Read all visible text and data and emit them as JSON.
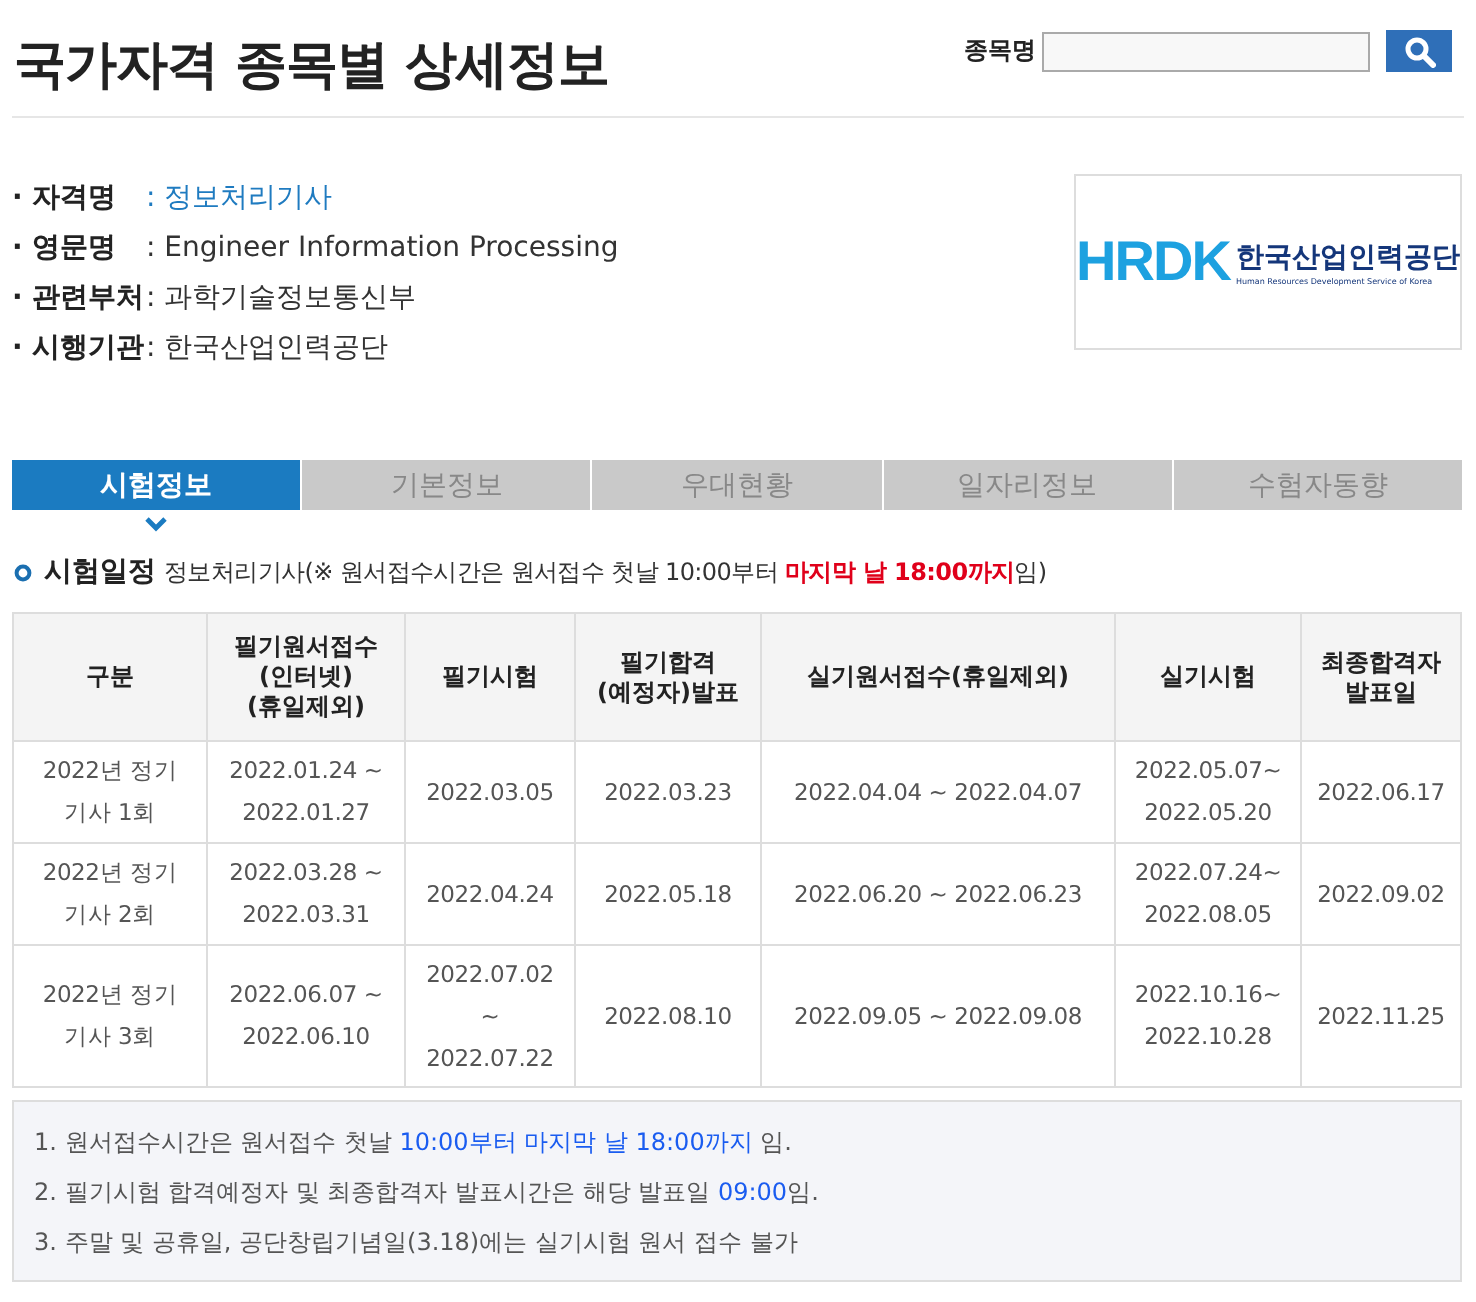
{
  "page_title": "국가자격 종목별 상세정보",
  "search": {
    "label": "종목명"
  },
  "info": [
    {
      "label": "· 자격명",
      "value": ": 정보처리기사",
      "link": true
    },
    {
      "label": "· 영문명",
      "value": ": Engineer Information Processing",
      "link": false
    },
    {
      "label": "· 관련부처",
      "value": ": 과학기술정보통신부",
      "link": false
    },
    {
      "label": "· 시행기관",
      "value": ": 한국산업인력공단",
      "link": false
    }
  ],
  "logo": {
    "mark": "HRDK",
    "name": "한국산업인력공단",
    "subtitle": "Human Resources Development Service of Korea"
  },
  "tabs": [
    {
      "label": "시험정보",
      "selected": true
    },
    {
      "label": "기본정보",
      "selected": false
    },
    {
      "label": "우대현황",
      "selected": false
    },
    {
      "label": "일자리정보",
      "selected": false
    },
    {
      "label": "수험자동향",
      "selected": false
    }
  ],
  "section": {
    "title": "시험일정",
    "note": [
      {
        "text": "정보처리기사(※ 원서접수시간은 원서접수 첫날 10:00부터 ",
        "emphasis": false
      },
      {
        "text": "마지막 날 18:00까지",
        "emphasis": true
      },
      {
        "text": "임)",
        "emphasis": false
      }
    ]
  },
  "table": {
    "columns": [
      "구분",
      "필기원서접수(인터넷)(휴일제외)",
      "필기시험",
      "필기합격(예정자)발표",
      "실기원서접수(휴일제외)",
      "실기시험",
      "최종합격자 발표일"
    ],
    "rows": [
      [
        "2022년 정기 기사 1회",
        "2022.01.24 ~ 2022.01.27",
        "2022.03.05",
        "2022.03.23",
        "2022.04.04 ~ 2022.04.07",
        "2022.05.07~ 2022.05.20",
        "2022.06.17"
      ],
      [
        "2022년 정기 기사 2회",
        "2022.03.28 ~ 2022.03.31",
        "2022.04.24",
        "2022.05.18",
        "2022.06.20 ~ 2022.06.23",
        "2022.07.24~ 2022.08.05",
        "2022.09.02"
      ],
      [
        "2022년 정기 기사 3회",
        "2022.06.07 ~ 2022.06.10",
        "2022.07.02 ~ 2022.07.22",
        "2022.08.10",
        "2022.09.05 ~ 2022.09.08",
        "2022.10.16~ 2022.10.28",
        "2022.11.25"
      ]
    ]
  },
  "notes": [
    [
      {
        "text": "1. 원서접수시간은 원서접수 첫날 ",
        "emphasis": false
      },
      {
        "text": "10:00부터 마지막 날 18:00까지",
        "emphasis": true
      },
      {
        "text": " 임.",
        "emphasis": false
      }
    ],
    [
      {
        "text": "2. 필기시험 합격예정자 및 최종합격자 발표시간은 해당 발표일 ",
        "emphasis": false
      },
      {
        "text": "09:00",
        "emphasis": true
      },
      {
        "text": "임.",
        "emphasis": false
      }
    ],
    [
      {
        "text": "3. 주말 및 공휴일, 공단창립기념일(3.18)에는 실기시험 원서 접수 불가",
        "emphasis": false
      }
    ]
  ]
}
